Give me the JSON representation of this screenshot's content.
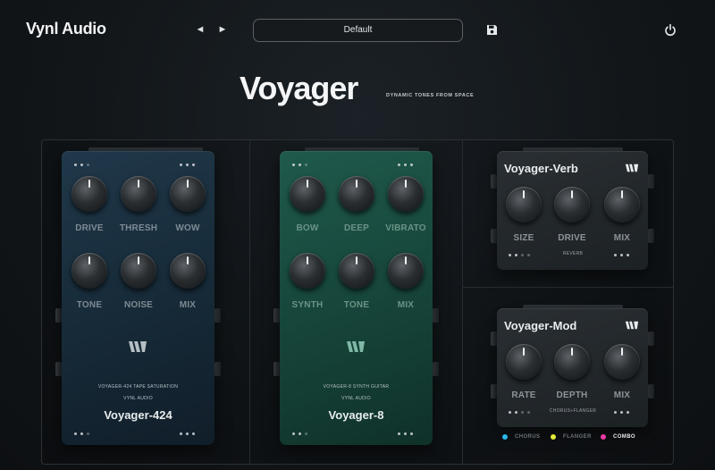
{
  "header": {
    "brand": "Vynl Audio",
    "prev_label": "◄",
    "next_label": "►",
    "preset_name": "Default",
    "save_icon": "floppy-disk-icon",
    "power_icon": "power-icon"
  },
  "hero": {
    "title": "Voyager",
    "tagline": "DYNAMIC TONES FROM SPACE"
  },
  "pedals": {
    "p424": {
      "knobs": [
        "DRIVE",
        "THRESH",
        "WOW",
        "TONE",
        "NOISE",
        "MIX"
      ],
      "subline_1": "VOYAGER-424   TAPE SATURATION",
      "subline_2": "VYNL AUDIO",
      "name": "Voyager-424"
    },
    "p8": {
      "knobs": [
        "BOW",
        "DEEP",
        "VIBRATO",
        "SYNTH",
        "TONE",
        "MIX"
      ],
      "subline_1": "VOYAGER-8      SYNTH GUITAR",
      "subline_2": "VYNL AUDIO",
      "name": "Voyager-8"
    },
    "verb": {
      "name": "Voyager-Verb",
      "knobs": [
        "SIZE",
        "DRIVE",
        "MIX"
      ],
      "mode": "REVERB"
    },
    "mod": {
      "name": "Voyager-Mod",
      "knobs": [
        "RATE",
        "DEPTH",
        "MIX"
      ],
      "mode": "CHORUS+FLANGER"
    }
  },
  "mod_modes": [
    {
      "label": "CHORUS",
      "color": "#29b6e8",
      "active": false
    },
    {
      "label": "FLANGER",
      "color": "#e4e83a",
      "active": false
    },
    {
      "label": "COMBO",
      "color": "#e83aa4",
      "active": true
    }
  ]
}
